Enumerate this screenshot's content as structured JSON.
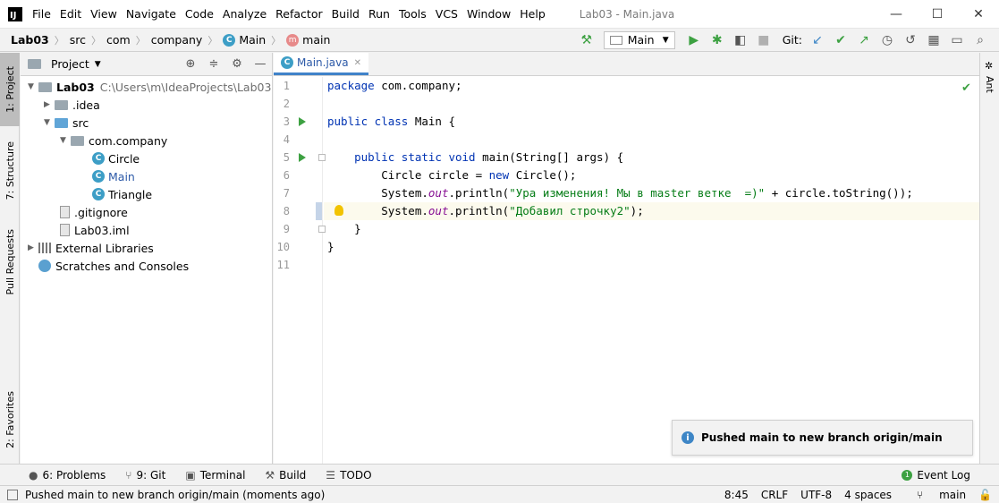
{
  "window": {
    "title": "Lab03 - Main.java",
    "menu": [
      "File",
      "Edit",
      "View",
      "Navigate",
      "Code",
      "Analyze",
      "Refactor",
      "Build",
      "Run",
      "Tools",
      "VCS",
      "Window",
      "Help"
    ],
    "controls": [
      "—",
      "☐",
      "✕"
    ]
  },
  "breadcrumbs": [
    "Lab03",
    "src",
    "com",
    "company",
    "Main",
    "main"
  ],
  "toolbar": {
    "run_config": "Main",
    "git_label": "Git:"
  },
  "left_tabs": [
    "1: Project",
    "7: Structure",
    "Pull Requests",
    "2: Favorites"
  ],
  "right_tabs": [
    "Ant"
  ],
  "project": {
    "title": "Project",
    "tree": [
      {
        "label": "Lab03",
        "path": "C:\\Users\\m\\IdeaProjects\\Lab03"
      },
      {
        "label": ".idea"
      },
      {
        "label": "src"
      },
      {
        "label": "com.company"
      },
      {
        "label": "Circle"
      },
      {
        "label": "Main"
      },
      {
        "label": "Triangle"
      },
      {
        "label": ".gitignore"
      },
      {
        "label": "Lab03.iml"
      },
      {
        "label": "External Libraries"
      },
      {
        "label": "Scratches and Consoles"
      }
    ]
  },
  "editor": {
    "tab": "Main.java",
    "line_numbers": [
      "1",
      "2",
      "3",
      "4",
      "5",
      "6",
      "7",
      "8",
      "9",
      "10",
      "11"
    ],
    "lines": {
      "l1_kw": "package",
      "l1_rest": " com.company;",
      "l3_kw": "public class",
      "l3_rest": " Main {",
      "l5_indent": "    ",
      "l5_kw": "public static void",
      "l5_rest": " main(String[] args) {",
      "l6_a": "        Circle circle = ",
      "l6_kw": "new",
      "l6_b": " Circle();",
      "l7_a": "        System.",
      "l7_it": "out",
      "l7_b": ".println(",
      "l7_str": "\"Ура изменения! Мы в master ветке  =)\"",
      "l7_c": " + circle.toString());",
      "l8_a": "        System.",
      "l8_it": "out",
      "l8_b": ".println(",
      "l8_str": "\"Добавил строчку2\"",
      "l8_c": ");",
      "l9": "    }",
      "l10": "}"
    }
  },
  "notification": {
    "text": "Pushed main to new branch origin/main"
  },
  "bottom_tabs": [
    "6: Problems",
    "9: Git",
    "Terminal",
    "Build",
    "TODO"
  ],
  "event_log": "Event Log",
  "status": {
    "message": "Pushed main to new branch origin/main (moments ago)",
    "position": "8:45",
    "line_sep": "CRLF",
    "encoding": "UTF-8",
    "indent": "4 spaces",
    "branch": "main"
  }
}
